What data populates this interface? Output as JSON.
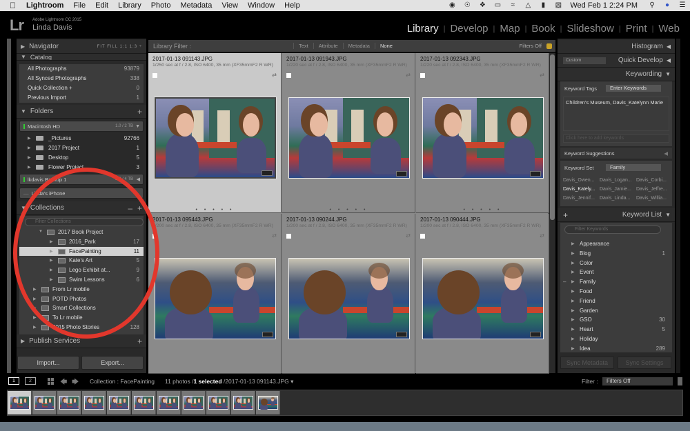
{
  "menubar": {
    "app": "Lightroom",
    "items": [
      "File",
      "Edit",
      "Library",
      "Photo",
      "Metadata",
      "View",
      "Window",
      "Help"
    ],
    "status_icons": [
      "creative-cloud-icon",
      "1password-icon",
      "dropbox-icon",
      "display-icon",
      "wifi-icon",
      "airplay-icon",
      "battery-icon",
      "keyboard-icon"
    ],
    "clock": "Wed Feb 1  2:24 PM"
  },
  "identity": {
    "logo": "Lr",
    "product": "Adobe Lightroom CC 2015",
    "user": "Linda Davis"
  },
  "modules": [
    {
      "label": "Library",
      "active": true
    },
    {
      "label": "Develop"
    },
    {
      "label": "Map"
    },
    {
      "label": "Book"
    },
    {
      "label": "Slideshow"
    },
    {
      "label": "Print"
    },
    {
      "label": "Web"
    }
  ],
  "left": {
    "navigator": {
      "title": "Navigator",
      "options": "FIT   FILL   1:1   1:3 ÷"
    },
    "catalog": {
      "title": "Catalog",
      "rows": [
        {
          "label": "All Photographs",
          "count": "93879"
        },
        {
          "label": "All Synced Photographs",
          "count": "338"
        },
        {
          "label": "Quick Collection +",
          "count": "0"
        },
        {
          "label": "Previous Import",
          "count": "1"
        }
      ]
    },
    "folders": {
      "title": "Folders",
      "volume1": {
        "name": "Macintosh HD",
        "capacity": "1.0 / 2 TB"
      },
      "rows": [
        {
          "label": "_Pictures",
          "count": "92766"
        },
        {
          "label": "2017 Project",
          "count": "1"
        },
        {
          "label": "Desktop",
          "count": "5"
        },
        {
          "label": "Flower Project",
          "count": "3"
        }
      ],
      "volume2": {
        "name": "lkdavis Backup 1",
        "capacity": "2.3 / 4 TB"
      },
      "volume3": {
        "name": "Linda's iPhone"
      }
    },
    "collections": {
      "title": "Collections",
      "filter_placeholder": "Filter Collections",
      "rows": [
        {
          "label": "2017 Book Project",
          "count": "",
          "indent": 1,
          "set": true
        },
        {
          "label": "2016_Park",
          "count": "17",
          "indent": 2
        },
        {
          "label": "FacePainting",
          "count": "11",
          "indent": 2,
          "selected": true
        },
        {
          "label": "Kate's Art",
          "count": "5",
          "indent": 2
        },
        {
          "label": "Lego Exhibit at...",
          "count": "9",
          "indent": 2
        },
        {
          "label": "Swim Lessons",
          "count": "6",
          "indent": 2
        },
        {
          "label": "From Lr mobile",
          "count": "",
          "indent": 0,
          "set": true
        },
        {
          "label": "POTD Photos",
          "count": "",
          "indent": 0,
          "set": true
        },
        {
          "label": "Smart Collections",
          "count": "",
          "indent": 0,
          "set": true
        },
        {
          "label": "To Lr mobile",
          "count": "",
          "indent": 0,
          "set": true
        },
        {
          "label": "2015 Photo Stories",
          "count": "128",
          "indent": 0
        }
      ]
    },
    "publish": {
      "title": "Publish Services"
    },
    "import_label": "Import...",
    "export_label": "Export..."
  },
  "filterbar": {
    "title": "Library Filter :",
    "options": [
      "Text",
      "Attribute",
      "Metadata",
      "None"
    ],
    "active": "None",
    "status": "Filters Off"
  },
  "grid": {
    "cells": [
      {
        "file": "2017-01-13 091143.JPG",
        "exif": "1/250 sec at f / 2.8, ISO 6400, 35 mm (XF35mmF2 R WR)",
        "selected": true
      },
      {
        "file": "2017-01-13 091943.JPG",
        "exif": "1/220 sec at f / 2.8, ISO 6400, 35 mm (XF35mmF2 R WR)"
      },
      {
        "file": "2017-01-13 092343.JPG",
        "exif": "1/220 sec at f / 2.8, ISO 6400, 35 mm (XF35mmF2 R WR)"
      },
      {
        "file": "2017-01-13 095443.JPG",
        "exif": "1/200 sec at f / 2.8, ISO 6400, 35 mm (XF35mmF2 R WR)"
      },
      {
        "file": "2017-01-13 090244.JPG",
        "exif": "1/200 sec at f / 2.8, ISO 6400, 35 mm (XF35mmF2 R WR)"
      },
      {
        "file": "2017-01-13 090444.JPG",
        "exif": "1/200 sec at f / 2.8, ISO 6400, 35 mm (XF35mmF2 R WR)"
      }
    ],
    "rating_dots": "• • • • •"
  },
  "right": {
    "histogram": "Histogram",
    "quick_develop": "Quick Develop",
    "quick_develop_preset": "Custom",
    "keywording": "Keywording",
    "keyword_tags_label": "Keyword Tags",
    "keyword_tags_mode": "Enter Keywords",
    "keywords": "Children's Museum, Davis_Katelynn Marie",
    "add_placeholder": "Click here to add keywords",
    "suggestions_title": "Keyword Suggestions",
    "keyword_set_label": "Keyword Set",
    "keyword_set_value": "Family",
    "set_items": [
      "Davis_Owen...",
      "Davis_Logan...",
      "Davis_Corbi...",
      "Davis_Kately...",
      "Davis_Jamie...",
      "Davis_Jeffre...",
      "Davis_Jennif...",
      "Davis_Linda...",
      "Davis_Willia..."
    ],
    "keyword_list_title": "Keyword List",
    "filter_placeholder": "Filter Keywords",
    "keyword_list": [
      {
        "label": "Appearance",
        "count": ""
      },
      {
        "label": "Blog",
        "count": "1"
      },
      {
        "label": "Color",
        "count": ""
      },
      {
        "label": "Event",
        "count": ""
      },
      {
        "label": "Family",
        "count": ""
      },
      {
        "label": "Food",
        "count": ""
      },
      {
        "label": "Friend",
        "count": ""
      },
      {
        "label": "Garden",
        "count": ""
      },
      {
        "label": "GSO",
        "count": "30"
      },
      {
        "label": "Heart",
        "count": "5"
      },
      {
        "label": "Holiday",
        "count": ""
      },
      {
        "label": "Idea",
        "count": "289"
      }
    ],
    "sync_metadata": "Sync Metadata",
    "sync_settings": "Sync Settings"
  },
  "filmstrip": {
    "screen1": "1",
    "screen2": "2",
    "source": "Collection : FacePainting",
    "count_prefix": "11 photos /",
    "selected": "1 selected",
    "count_suffix": " /2017-01-13 091143.JPG ▾",
    "filter_label": "Filter :",
    "filter_value": "Filters Off",
    "thumb_count": 11,
    "selected_index": 0
  }
}
